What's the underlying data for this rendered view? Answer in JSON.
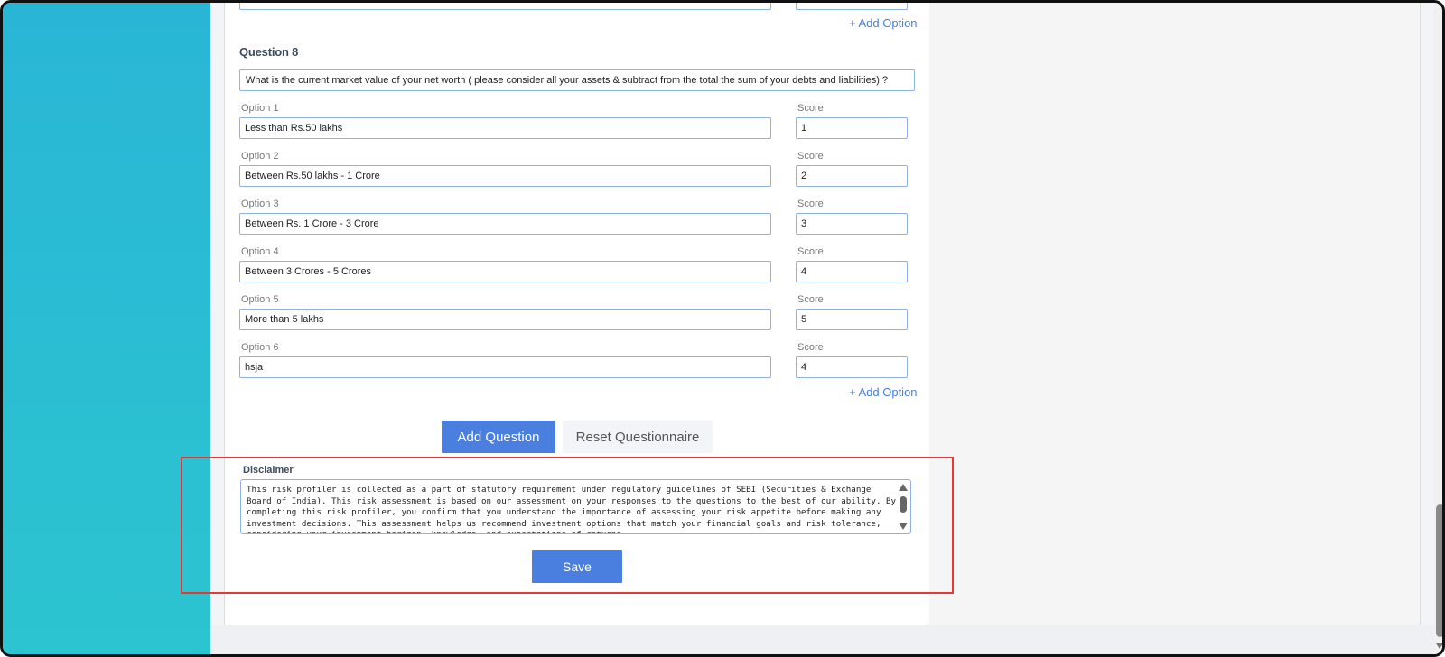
{
  "top_section": {
    "add_option_label": "+ Add Option"
  },
  "question": {
    "title": "Question 8",
    "text": "What is the current market value of your net worth ( please consider all your assets & subtract from the total the sum of your debts and liabilities) ?",
    "options": [
      {
        "label": "Option 1",
        "value": "Less than Rs.50 lakhs",
        "score_label": "Score",
        "score": "1"
      },
      {
        "label": "Option 2",
        "value": "Between Rs.50 lakhs - 1 Crore",
        "score_label": "Score",
        "score": "2"
      },
      {
        "label": "Option 3",
        "value": "Between Rs. 1 Crore - 3 Crore",
        "score_label": "Score",
        "score": "3"
      },
      {
        "label": "Option 4",
        "value": "Between 3 Crores - 5 Crores",
        "score_label": "Score",
        "score": "4"
      },
      {
        "label": "Option 5",
        "value": "More than 5 lakhs",
        "score_label": "Score",
        "score": "5"
      },
      {
        "label": "Option 6",
        "value": "hsja",
        "score_label": "Score",
        "score": "4"
      }
    ],
    "add_option_label": "+ Add Option"
  },
  "actions": {
    "add_question_label": "Add Question",
    "reset_label": "Reset Questionnaire",
    "save_label": "Save"
  },
  "disclaimer": {
    "label": "Disclaimer",
    "text": "This risk profiler is collected as a part of statutory requirement under regulatory guidelines of SEBI (Securities & Exchange Board of India). This risk assessment is based on our assessment on your responses to the questions to the best of our ability. By completing this risk profiler, you confirm that you understand the importance of assessing your risk appetite before making any investment decisions. This assessment helps us recommend investment options that match your financial goals and risk tolerance, considering your investment horizon, knowledge, and expectations of returns."
  },
  "colors": {
    "sidebar": "#29b6d6",
    "primary_button": "#4a7fe0",
    "highlight_border": "#e53935",
    "link": "#4a7fd9"
  }
}
